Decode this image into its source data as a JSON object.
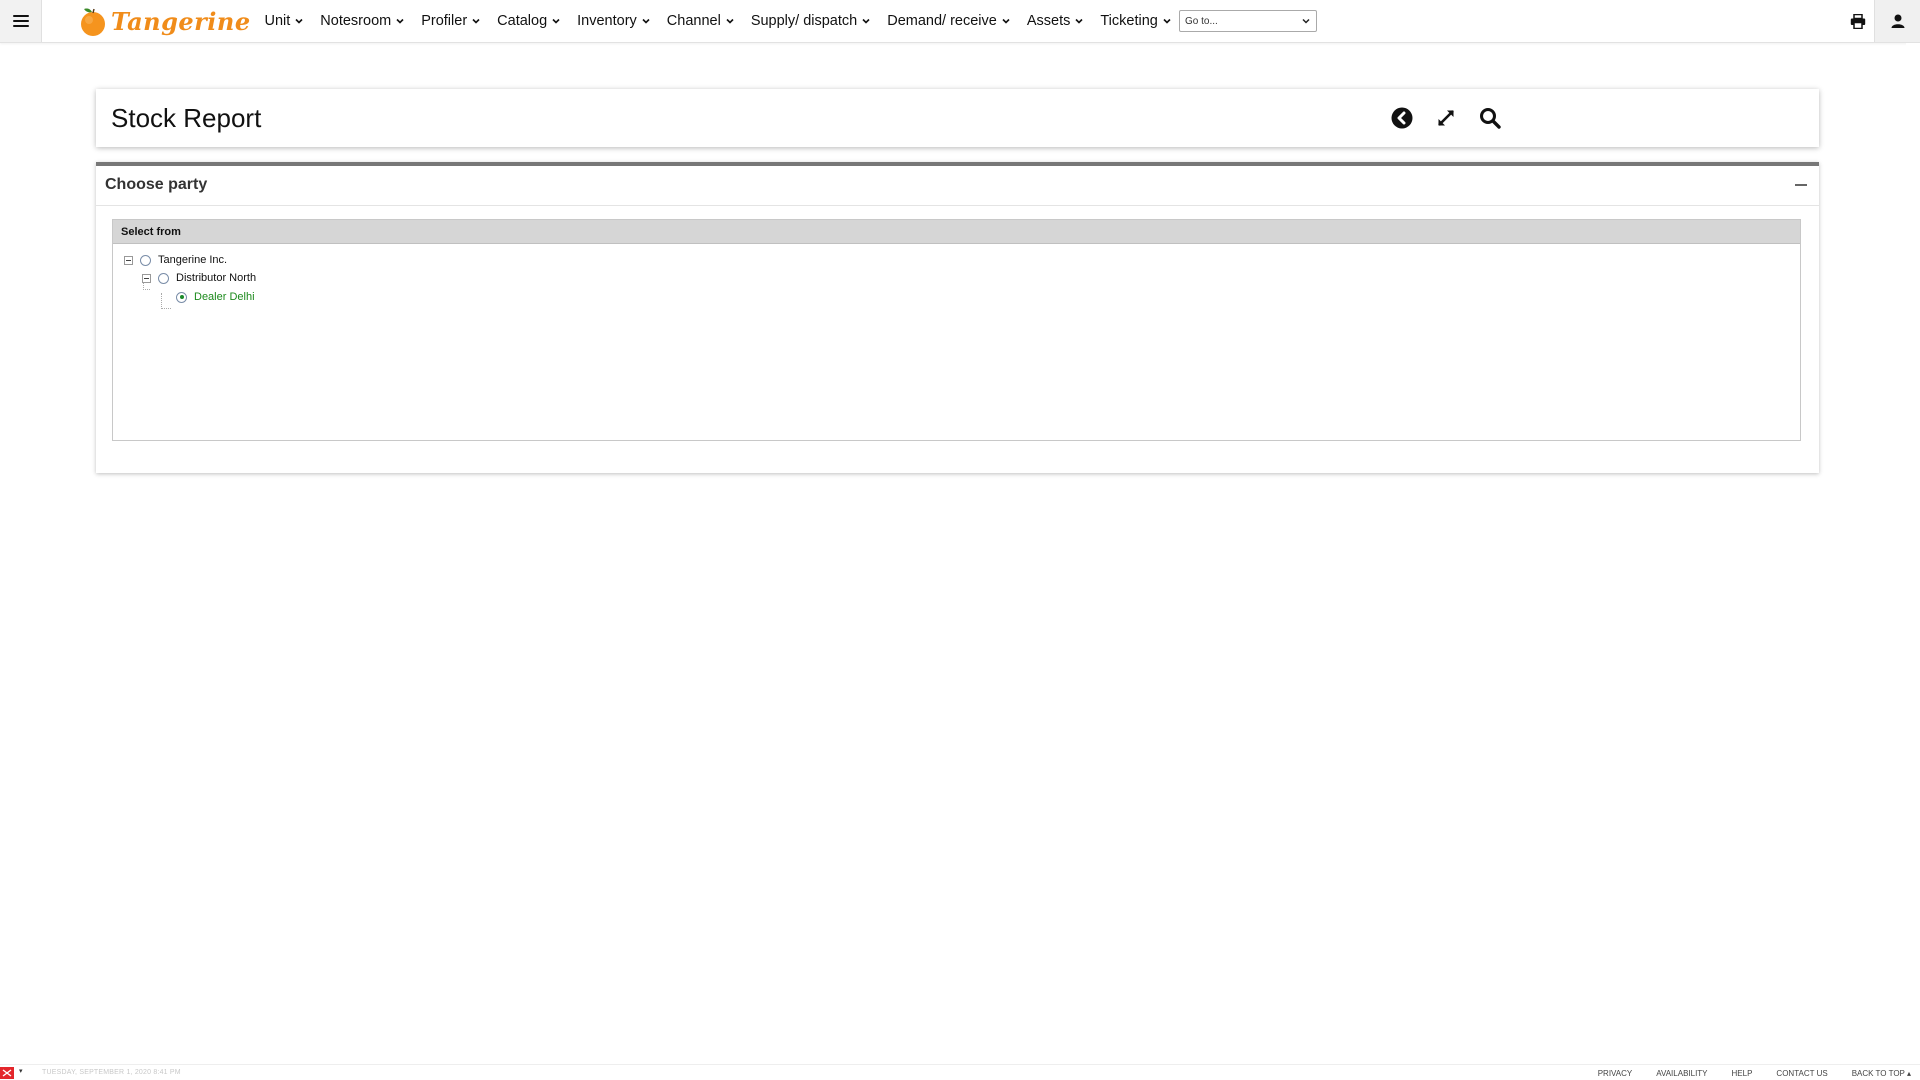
{
  "app": {
    "logo_text": "Tangerine",
    "brand_color": "#f08c1a"
  },
  "nav": {
    "menu": [
      {
        "label": "Unit"
      },
      {
        "label": "Notesroom"
      },
      {
        "label": "Profiler"
      },
      {
        "label": "Catalog"
      },
      {
        "label": "Inventory"
      },
      {
        "label": "Channel"
      },
      {
        "label": "Supply/ dispatch"
      },
      {
        "label": "Demand/ receive"
      },
      {
        "label": "Assets"
      },
      {
        "label": "Ticketing"
      }
    ],
    "goto": {
      "value": "Go to..."
    },
    "icons": {
      "menu": "hamburger-icon",
      "print": "printer-icon",
      "user": "user-icon"
    }
  },
  "page": {
    "title": "Stock Report",
    "actions": {
      "back": "back-icon",
      "expand": "expand-icon",
      "search": "search-icon"
    }
  },
  "panel": {
    "title": "Choose party",
    "tree_header": "Select from",
    "tree": [
      {
        "label": "Tangerine Inc.",
        "level": 0,
        "selected": false
      },
      {
        "label": "Distributor North",
        "level": 1,
        "selected": false
      },
      {
        "label": "Dealer Delhi",
        "level": 2,
        "selected": true
      }
    ],
    "selected_color": "#1c8a1c"
  },
  "footer": {
    "date": "TUESDAY, SEPTEMBER 1, 2020 8:41 PM",
    "links": [
      "PRIVACY",
      "AVAILABILITY",
      "HELP",
      "CONTACT US",
      "BACK TO TOP ▴"
    ]
  }
}
